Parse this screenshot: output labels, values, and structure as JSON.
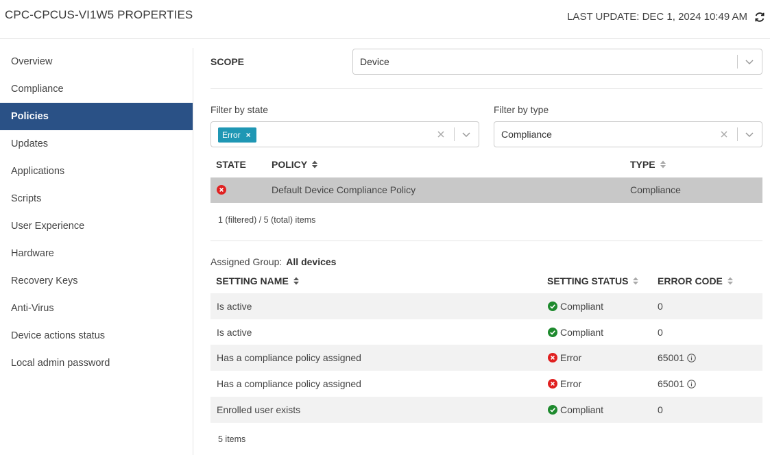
{
  "header": {
    "title": "CPC-CPCUS-VI1W5 PROPERTIES",
    "last_update": "LAST UPDATE: DEC 1, 2024 10:49 AM",
    "refresh_icon": "refresh-icon"
  },
  "sidebar": {
    "items": [
      {
        "label": "Overview",
        "active": false
      },
      {
        "label": "Compliance",
        "active": false
      },
      {
        "label": "Policies",
        "active": true
      },
      {
        "label": "Updates",
        "active": false
      },
      {
        "label": "Applications",
        "active": false
      },
      {
        "label": "Scripts",
        "active": false
      },
      {
        "label": "User Experience",
        "active": false
      },
      {
        "label": "Hardware",
        "active": false
      },
      {
        "label": "Recovery Keys",
        "active": false
      },
      {
        "label": "Anti-Virus",
        "active": false
      },
      {
        "label": "Device actions status",
        "active": false
      },
      {
        "label": "Local admin password",
        "active": false
      }
    ],
    "active_color": "#2a5186"
  },
  "scope": {
    "label": "SCOPE",
    "value": "Device"
  },
  "filters": {
    "state": {
      "label": "Filter by state",
      "tag": "Error",
      "tag_color": "#1f97b4"
    },
    "type": {
      "label": "Filter by type",
      "value": "Compliance"
    }
  },
  "policy_table": {
    "headers": {
      "state": "STATE",
      "policy": "POLICY",
      "type": "TYPE"
    },
    "rows": [
      {
        "state_icon": "error-icon",
        "policy": "Default Device Compliance Policy",
        "type": "Compliance"
      }
    ],
    "count": "1 (filtered) / 5 (total) items"
  },
  "assigned_group": {
    "label": "Assigned Group:",
    "value": "All devices"
  },
  "settings_table": {
    "headers": {
      "name": "SETTING NAME",
      "status": "SETTING STATUS",
      "code": "ERROR CODE"
    },
    "rows": [
      {
        "name": "Is active",
        "status": "Compliant",
        "status_icon": "check-icon",
        "code": "0",
        "info": false
      },
      {
        "name": "Is active",
        "status": "Compliant",
        "status_icon": "check-icon",
        "code": "0",
        "info": false
      },
      {
        "name": "Has a compliance policy assigned",
        "status": "Error",
        "status_icon": "error-icon",
        "code": "65001",
        "info": true
      },
      {
        "name": "Has a compliance policy assigned",
        "status": "Error",
        "status_icon": "error-icon",
        "code": "65001",
        "info": true
      },
      {
        "name": "Enrolled user exists",
        "status": "Compliant",
        "status_icon": "check-icon",
        "code": "0",
        "info": false
      }
    ],
    "count": "5 items"
  },
  "colors": {
    "compliant": "#1e8a2e",
    "error": "#e02020"
  }
}
